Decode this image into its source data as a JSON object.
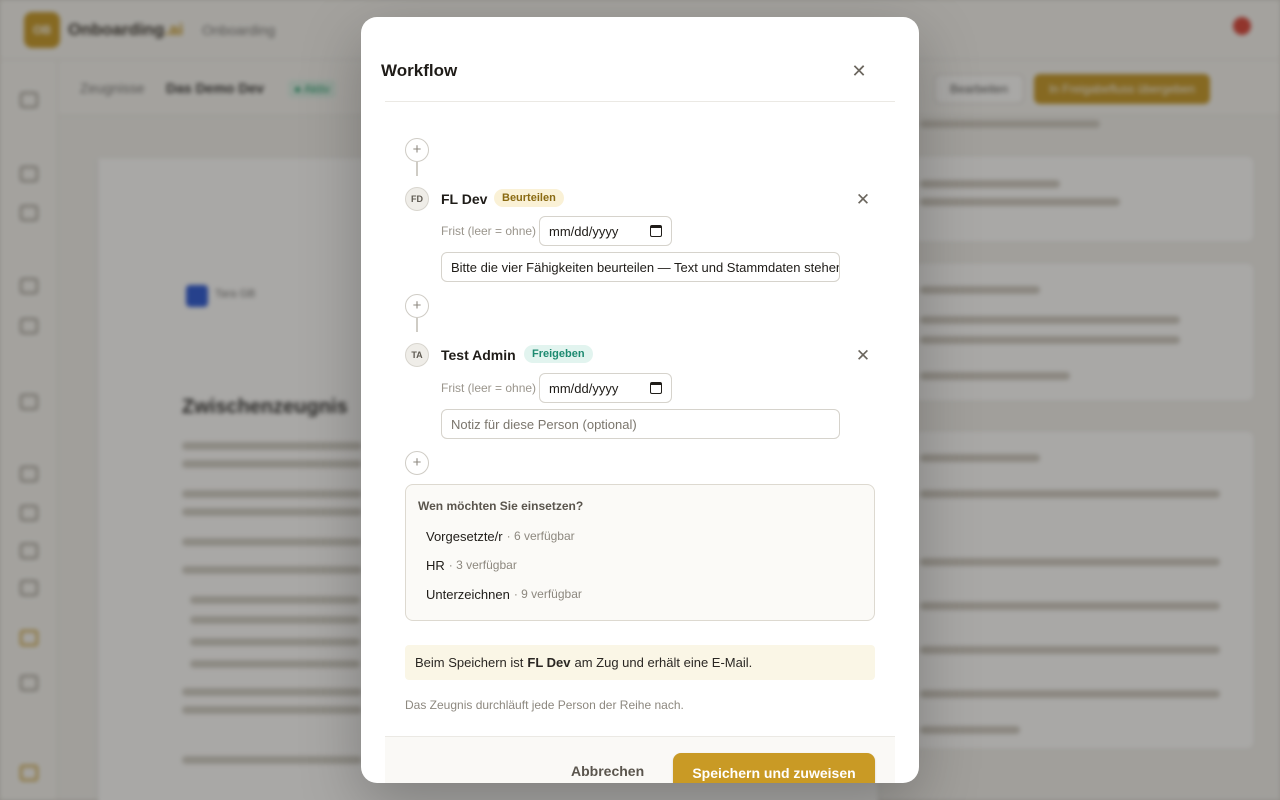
{
  "background": {
    "logo_initials": "OB",
    "brand_name": "Onboarding",
    "brand_suffix": ".ai",
    "section": "Onboarding",
    "breadcrumb": "Zeugnisse",
    "employee": "Das Demo Dev",
    "status_badge": "● Aktiv",
    "edit_button": "Bearbeiten",
    "primary_button": "In Freigabefluss übergeben",
    "document_title": "Zwischenzeugnis",
    "document_logo_text": "Tara GB"
  },
  "modal": {
    "title": "Workflow",
    "close_icon": "close-icon",
    "steps": [
      {
        "initials": "FD",
        "name": "FL Dev",
        "role": "Beurteilen",
        "deadline_label": "Frist (leer = ohne)",
        "deadline_value": "mm/dd/yyyy",
        "note_value": "Bitte die vier Fähigkeiten beurteilen — Text und Stammdaten stehen",
        "note_placeholder": ""
      },
      {
        "initials": "TA",
        "name": "Test Admin",
        "role": "Freigeben",
        "deadline_label": "Frist (leer = ohne)",
        "deadline_value": "mm/dd/yyyy",
        "note_value": "",
        "note_placeholder": "Notiz für diese Person (optional)"
      }
    ],
    "picker": {
      "title": "Wen möchten Sie einsetzen?",
      "options": [
        {
          "label": "Vorgesetzte/r",
          "available": "· 6 verfügbar"
        },
        {
          "label": "HR",
          "available": "· 3 verfügbar"
        },
        {
          "label": "Unterzeichnen",
          "available": "· 9 verfügbar"
        }
      ]
    },
    "info": {
      "prefix": "Beim Speichern ist",
      "person": "FL Dev",
      "suffix": "am Zug und erhält eine E-Mail."
    },
    "hint": "Das Zeugnis durchläuft jede Person der Reihe nach.",
    "cancel_label": "Abbrechen",
    "save_label": "Speichern und zuweisen"
  },
  "colors": {
    "accent": "#c99a25",
    "role_beurteilen_bg": "#faf1d6",
    "role_freigeben_bg": "#e2f4ef",
    "info_bg": "#faf6e6"
  }
}
